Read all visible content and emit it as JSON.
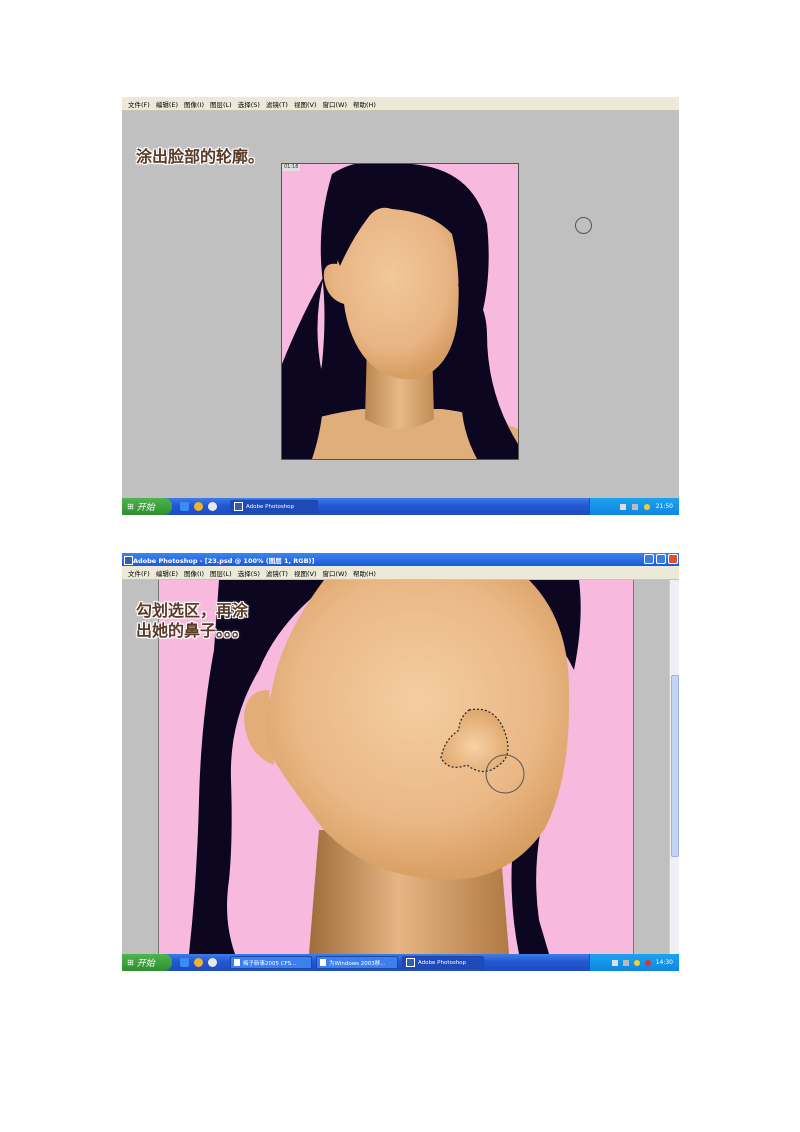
{
  "menu_items": [
    "文件(F)",
    "编辑(E)",
    "图像(I)",
    "图层(L)",
    "选择(S)",
    "滤镜(T)",
    "视图(V)",
    "窗口(W)",
    "帮助(H)"
  ],
  "screenshot1": {
    "caption": "涂出脸部的轮廓。",
    "doc_tab": "01:18",
    "taskbar": {
      "start_label": "开始",
      "tasks": [
        "Adobe Photoshop"
      ],
      "clock": "21:50"
    }
  },
  "screenshot2": {
    "title": "Adobe Photoshop - [23.psd @ 100% (图层 1, RGB)]",
    "caption_line1": "勾划选区，再涂",
    "caption_line2": "出她的鼻子。。。",
    "taskbar": {
      "start_label": "开始",
      "tasks": [
        "梅子新事2005 CFS...",
        "为Windows 2003移...",
        "Adobe Photoshop"
      ],
      "clock": "14:30"
    }
  },
  "colors": {
    "workspace_gray": "#c0c0c0",
    "background_pink": "#f7b9dd",
    "hair": "#0d0620",
    "skin": "#e8b987",
    "taskbar_blue": "#2357d1",
    "start_green": "#3b9e3b"
  }
}
